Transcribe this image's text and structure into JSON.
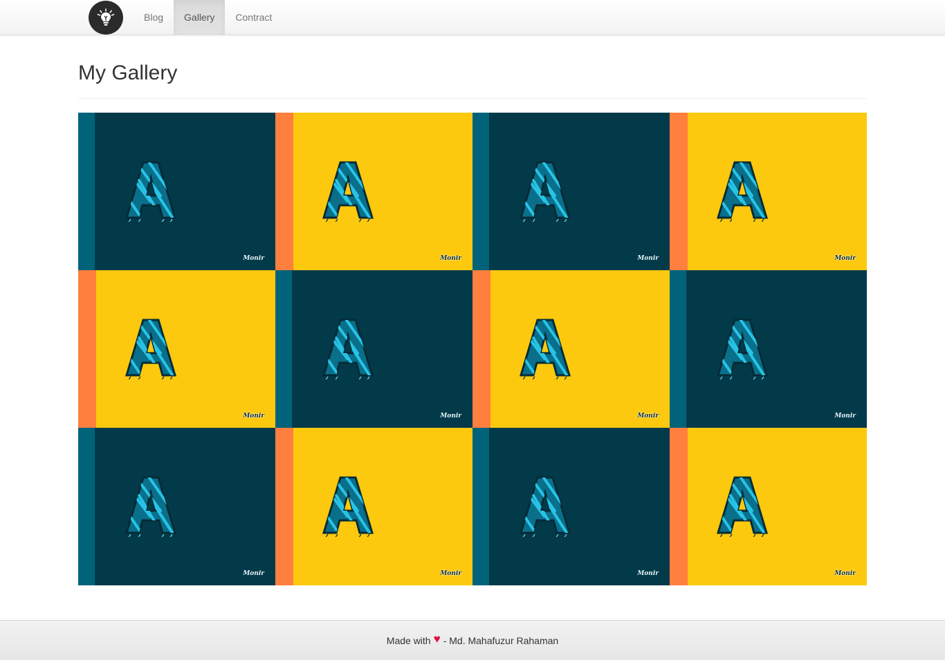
{
  "nav": {
    "brand_icon": "lightbulb-icon",
    "items": [
      {
        "label": "Blog",
        "active": false
      },
      {
        "label": "Gallery",
        "active": true
      },
      {
        "label": "Contract",
        "active": false
      }
    ]
  },
  "header": {
    "title": "My Gallery"
  },
  "gallery": {
    "colors": {
      "dark": "#023a4a",
      "dark_stripe": "#00637a",
      "yellow": "#fdc90e",
      "yellow_stripe": "#ff7f3f",
      "letter": "#27c3e6"
    },
    "tiles": [
      {
        "theme": "dark",
        "letter": "A",
        "signature": "Monir"
      },
      {
        "theme": "yellow",
        "letter": "A",
        "signature": "Monir"
      },
      {
        "theme": "dark",
        "letter": "A",
        "signature": "Monir"
      },
      {
        "theme": "yellow",
        "letter": "A",
        "signature": "Monir"
      },
      {
        "theme": "yellow",
        "letter": "A",
        "signature": "Monir"
      },
      {
        "theme": "dark",
        "letter": "A",
        "signature": "Monir"
      },
      {
        "theme": "yellow",
        "letter": "A",
        "signature": "Monir"
      },
      {
        "theme": "dark",
        "letter": "A",
        "signature": "Monir"
      },
      {
        "theme": "dark",
        "letter": "A",
        "signature": "Monir"
      },
      {
        "theme": "yellow",
        "letter": "A",
        "signature": "Monir"
      },
      {
        "theme": "dark",
        "letter": "A",
        "signature": "Monir"
      },
      {
        "theme": "yellow",
        "letter": "A",
        "signature": "Monir"
      }
    ]
  },
  "footer": {
    "prefix": "Made with",
    "heart_icon": "heart-icon",
    "suffix": "- Md. Mahafuzur Rahaman"
  }
}
